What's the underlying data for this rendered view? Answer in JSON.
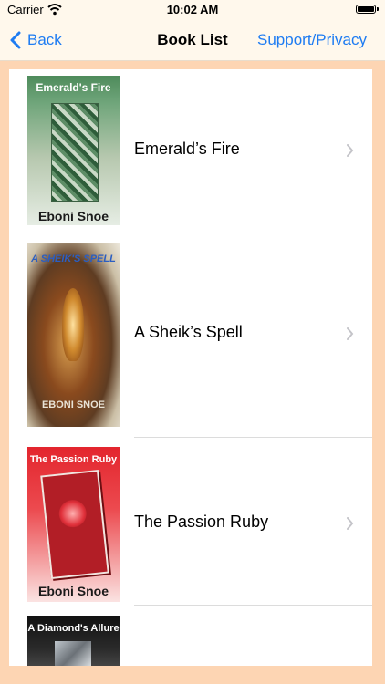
{
  "status": {
    "carrier": "Carrier",
    "time": "10:02 AM"
  },
  "nav": {
    "back_label": "Back",
    "title": "Book List",
    "support_label": "Support/Privacy"
  },
  "books": [
    {
      "title": "Emerald’s Fire",
      "cover_title": "Emerald's Fire",
      "cover_author": "Eboni Snoe"
    },
    {
      "title": "A Sheik’s Spell",
      "cover_title": "A SHEIK'S SPELL",
      "cover_author": "EBONI SNOE"
    },
    {
      "title": "The Passion Ruby",
      "cover_title": "The Passion Ruby",
      "cover_author": "Eboni Snoe"
    },
    {
      "title": "",
      "cover_title": "A Diamond's Allure",
      "cover_author": ""
    }
  ],
  "colors": {
    "background": "#FDD5B3",
    "bar": "#FFF8EC",
    "accent": "#1E7CF2"
  }
}
